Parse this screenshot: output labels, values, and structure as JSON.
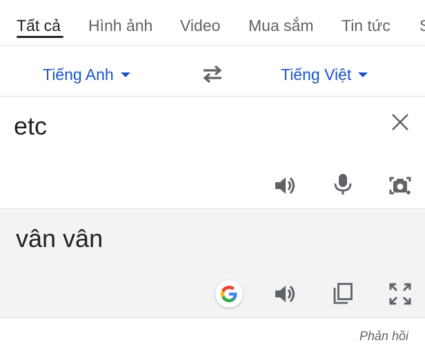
{
  "tabs": [
    {
      "label": "Tất cả",
      "active": true
    },
    {
      "label": "Hình ảnh"
    },
    {
      "label": "Video"
    },
    {
      "label": "Mua sắm"
    },
    {
      "label": "Tin tức"
    },
    {
      "label": "S"
    }
  ],
  "translator": {
    "source_language": "Tiếng Anh",
    "target_language": "Tiếng Việt",
    "source_text": "etc",
    "result_text": "vân vân"
  },
  "feedback_label": "Phản hồi",
  "colors": {
    "accent_blue": "#1a55c6",
    "icon_gray": "#5f6368",
    "result_bg": "#f1f3f4"
  },
  "icons": {
    "swap": "swap-arrows-icon",
    "clear": "close-icon",
    "speaker": "speaker-icon",
    "mic": "microphone-icon",
    "camera": "camera-search-icon",
    "google": "google-logo-icon",
    "copy": "copy-icon",
    "fullscreen": "fullscreen-icon"
  }
}
